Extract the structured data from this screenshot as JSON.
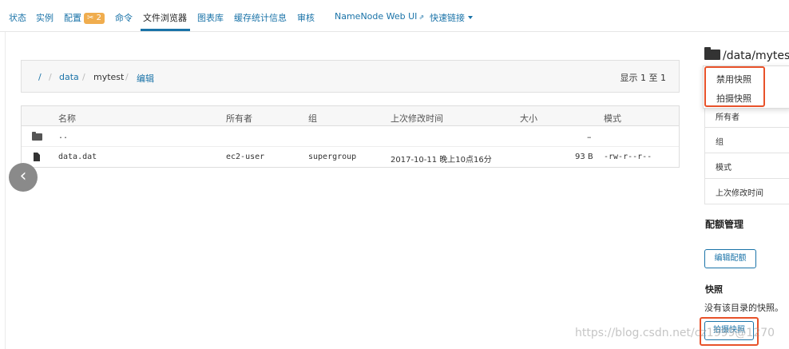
{
  "nav": {
    "items": [
      "状态",
      "实例",
      "配置",
      "命令",
      "文件浏览器",
      "图表库",
      "缓存统计信息",
      "审核",
      "NameNode Web UI",
      "快速链接"
    ],
    "config_badge": "2",
    "active": "文件浏览器"
  },
  "breadcrumb": {
    "root": "/",
    "sep": "/",
    "data": "data",
    "mytest": "mytest",
    "edit": "编辑"
  },
  "showing": "显示 1 至 1",
  "table": {
    "headers": [
      "名称",
      "所有者",
      "组",
      "上次修改时间",
      "大小",
      "模式"
    ],
    "rows": [
      {
        "name": "..",
        "owner": "",
        "group": "",
        "modified": "",
        "size": "–",
        "mode": ""
      },
      {
        "name": "data.dat",
        "owner": "ec2-user",
        "group": "supergroup",
        "modified": "2017-10-11 晚上10点16分",
        "size": "93 B",
        "mode": "-rw-r--r--"
      }
    ]
  },
  "right_panel": {
    "title": "/data/mytest",
    "menu": [
      "禁用快照",
      "拍摄快照"
    ],
    "props": [
      "所有者",
      "组",
      "模式",
      "上次修改时间"
    ],
    "quota_title": "配额管理",
    "edit_quota": "编辑配额",
    "snapshot_label": "快照",
    "no_snapshot": "没有该目录的快照。",
    "take_snapshot": "拍摄快照"
  },
  "watermark": "https://blog.csdn.net/cz1999@1270",
  "colors": {
    "link": "#1a73a8",
    "badge": "#f0ad4e",
    "highlight": "#e8522a"
  }
}
